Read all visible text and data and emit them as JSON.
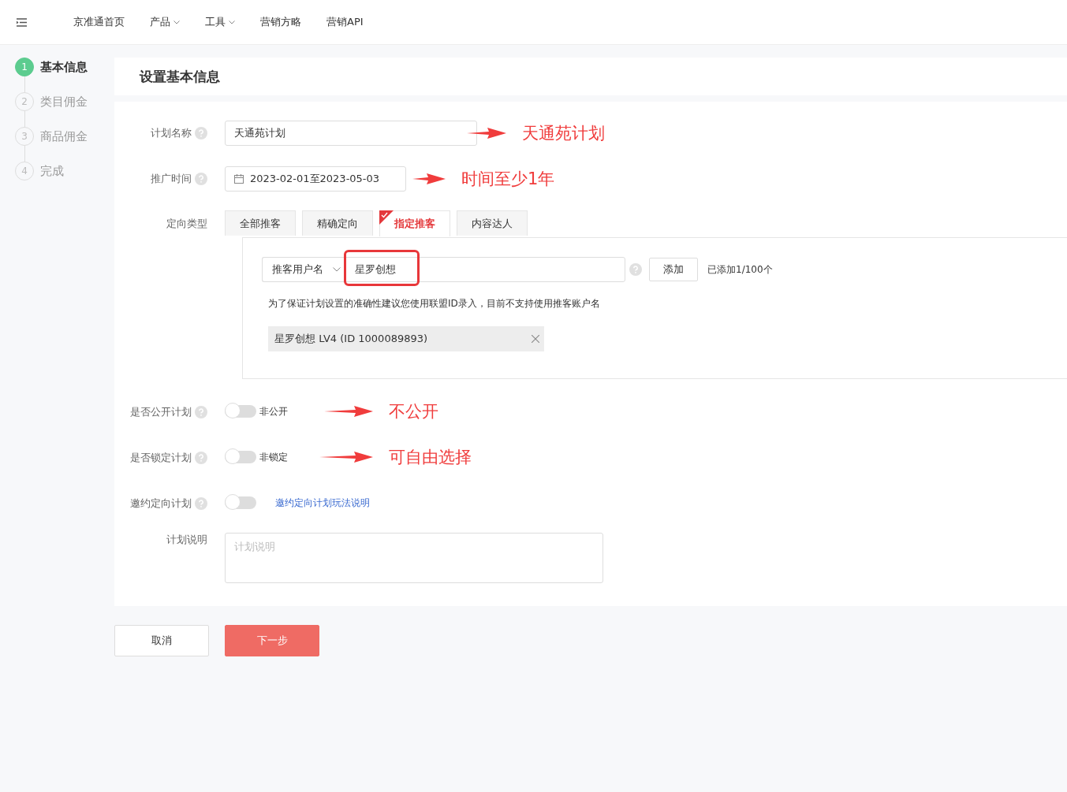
{
  "nav": {
    "items": [
      {
        "label": "京准通首页",
        "dropdown": false
      },
      {
        "label": "产品",
        "dropdown": true
      },
      {
        "label": "工具",
        "dropdown": true
      },
      {
        "label": "营销方略",
        "dropdown": false
      },
      {
        "label": "营销API",
        "dropdown": false
      }
    ]
  },
  "steps": [
    {
      "number": "1",
      "label": "基本信息",
      "selected": true
    },
    {
      "number": "2",
      "label": "类目佣金",
      "selected": false
    },
    {
      "number": "3",
      "label": "商品佣金",
      "selected": false
    },
    {
      "number": "4",
      "label": "完成",
      "selected": false
    }
  ],
  "page_title": "设置基本信息",
  "plan_name": {
    "label": "计划名称",
    "value": "天通苑计划",
    "annotation": "天通苑计划"
  },
  "promo_time": {
    "label": "推广时间",
    "value": "2023-02-01至2023-05-03",
    "annotation": "时间至少1年"
  },
  "targeting": {
    "label": "定向类型",
    "tabs": [
      {
        "label": "全部推客",
        "selected": false
      },
      {
        "label": "精确定向",
        "selected": false
      },
      {
        "label": "指定推客",
        "selected": true
      },
      {
        "label": "内容达人",
        "selected": false
      }
    ],
    "select": "推客用户名",
    "input": "星罗创想",
    "input_highlighted": true,
    "add_button": "添加",
    "count": "已添加1/100个",
    "hint": "为了保证计划设置的准确性建议您使用联盟ID录入，目前不支持使用推客账户名",
    "tags": [
      "星罗创想 LV4 (ID 1000089893)"
    ]
  },
  "switches": [
    {
      "label": "是否公开计划",
      "on": false,
      "kind": "text",
      "text": "非公开",
      "annotation": "不公开"
    },
    {
      "label": "是否锁定计划",
      "on": false,
      "kind": "text",
      "text": "非锁定",
      "annotation": "可自由选择"
    },
    {
      "label": "邀约定向计划",
      "on": false,
      "kind": "link",
      "text": "邀约定向计划玩法说明"
    }
  ],
  "description": {
    "label": "计划说明",
    "placeholder": "计划说明"
  },
  "buttons": {
    "cancel": "取消",
    "next": "下一步"
  }
}
